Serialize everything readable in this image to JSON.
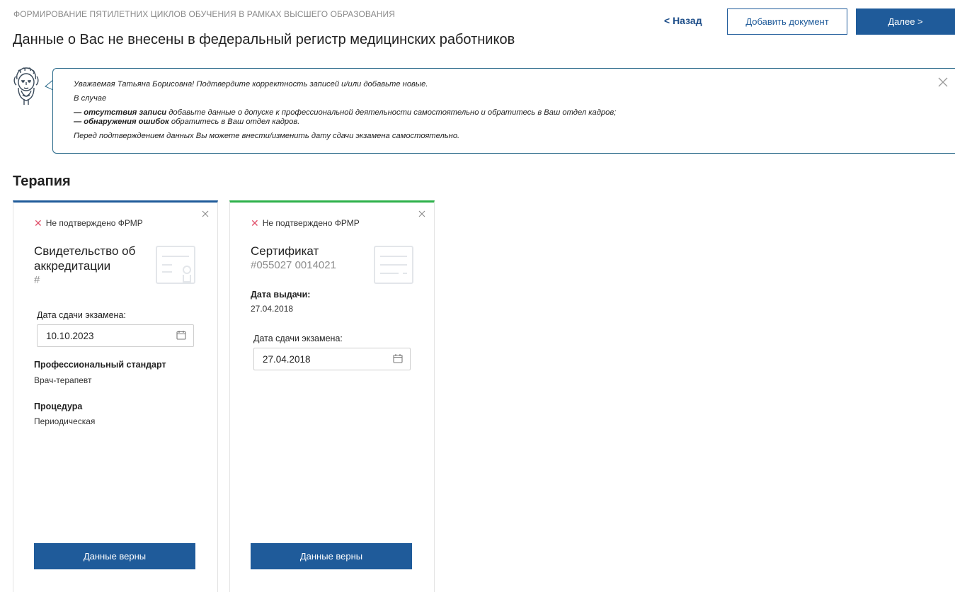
{
  "header": {
    "subtitle": "ФОРМИРОВАНИЕ ПЯТИЛЕТНИХ ЦИКЛОВ ОБУЧЕНИЯ В РАМКАХ ВЫСШЕГО ОБРАЗОВАНИЯ",
    "title": "Данные о Вас не внесены в федеральный регистр медицинских работников",
    "back_label": "< Назад",
    "add_document_label": "Добавить документ",
    "next_label": "Далее >"
  },
  "notice": {
    "line1": "Уважаемая Татьяна Борисовна! Подтвердите корректность записей и/или добавьте новые.",
    "line2": "В случае",
    "line3_bold": "— отсутствия записи",
    "line3_rest": " добавьте данные о допуске к профессиональной деятельности самостоятельно и обратитесь в Ваш отдел кадров;",
    "line4_bold": "— обнаружения ошибок",
    "line4_rest": " обратитесь в Ваш отдел кадров.",
    "line5": "Перед подтверждением данных Вы можете внести/изменить дату сдачи экзамена самостоятельно."
  },
  "section": {
    "title": "Терапия"
  },
  "cards": [
    {
      "status": "Не подтверждено ФРМР",
      "title_line1": "Свидетельство об",
      "title_line2": "аккредитации",
      "number": "#",
      "exam_date_label": "Дата сдачи экзамена:",
      "exam_date_value": "10.10.2023",
      "standard_label": "Профессиональный стандарт",
      "standard_value": "Врач-терапевт",
      "procedure_label": "Процедура",
      "procedure_value": "Периодическая",
      "confirm_label": "Данные верны"
    },
    {
      "status": "Не подтверждено ФРМР",
      "title_line1": "Сертификат",
      "number": "#055027 0014021",
      "issue_date_label": "Дата выдачи:",
      "issue_date_value": "27.04.2018",
      "exam_date_label": "Дата сдачи экзамена:",
      "exam_date_value": "27.04.2018",
      "confirm_label": "Данные верны"
    }
  ],
  "colors": {
    "primary": "#1f5b9a",
    "card1_accent": "#1f5b9a",
    "card2_accent": "#2db14a",
    "status_x": "#e0506a"
  }
}
